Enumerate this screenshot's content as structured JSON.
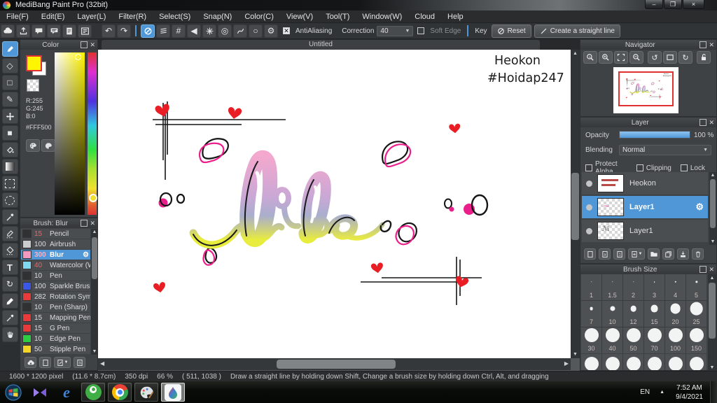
{
  "window": {
    "title": "MediBang Paint Pro (32bit)",
    "buttons": [
      "minimize",
      "restore",
      "close"
    ]
  },
  "menu": {
    "items": [
      "File(F)",
      "Edit(E)",
      "Layer(L)",
      "Filter(R)",
      "Select(S)",
      "Snap(N)",
      "Color(C)",
      "View(V)",
      "Tool(T)",
      "Window(W)",
      "Cloud",
      "Help"
    ]
  },
  "toolbar": {
    "icons": [
      "cloud",
      "export",
      "chat",
      "comment",
      "document",
      "panel-settings",
      "undo",
      "redo",
      "snap-off",
      "snap-parallel",
      "snap-grid",
      "snap-vanishing",
      "snap-radial",
      "snap-concentric",
      "snap-curve",
      "snap-ellipse",
      "snap-settings"
    ],
    "antialiasing_label": "AntiAliasing",
    "correction_label": "Correction",
    "correction_value": "40",
    "soft_edge_label": "Soft Edge",
    "key_label": "Key",
    "reset_label": "Reset",
    "straight_line_label": "Create a straight line"
  },
  "tools": {
    "items": [
      "brush",
      "eraser",
      "select-shape",
      "dot-pen",
      "move",
      "fill-shape",
      "bucket",
      "gradient",
      "select-rect",
      "lasso",
      "magic-wand",
      "select-pen",
      "select-eraser",
      "text",
      "operation",
      "pen",
      "eyedropper",
      "hand"
    ],
    "selected": "brush"
  },
  "color_panel": {
    "title": "Color",
    "r": "R:255",
    "g": "G:245",
    "b": "B:0",
    "hex": "#FFF500"
  },
  "brush_panel": {
    "title": "Brush: Blur",
    "footer_icons": [
      "cloud-upload",
      "add-brush",
      "edit-brush",
      "script-brush"
    ],
    "brushes": [
      {
        "size": "15",
        "name": "Pencil",
        "swatch": "#2f3133",
        "cls": "rednum"
      },
      {
        "size": "100",
        "name": "Airbrush",
        "swatch": "#c9cbcd"
      },
      {
        "size": "300",
        "name": "Blur",
        "swatch": "#f49ac1",
        "cls": "selected rednum"
      },
      {
        "size": "40",
        "name": "Watercolor (W",
        "swatch": "#7fd8ef",
        "cls": "rednum"
      },
      {
        "size": "10",
        "name": "Pen",
        "swatch": "#2f3133"
      },
      {
        "size": "100",
        "name": "Sparkle Brush",
        "swatch": "#3a57e8"
      },
      {
        "size": "282",
        "name": "Rotation Sym",
        "swatch": "#e83a3a"
      },
      {
        "size": "10",
        "name": "Pen (Sharp)",
        "swatch": "#2f3133"
      },
      {
        "size": "15",
        "name": "Mapping Pen",
        "swatch": "#e83a3a"
      },
      {
        "size": "15",
        "name": "G Pen",
        "swatch": "#e83a3a"
      },
      {
        "size": "10",
        "name": "Edge Pen",
        "swatch": "#2ecc40"
      },
      {
        "size": "50",
        "name": "Stipple Pen",
        "swatch": "#f5d523"
      }
    ]
  },
  "canvas": {
    "tab": "Untitled",
    "word": "like",
    "signature_line1": "Heokon",
    "signature_line2": "#Hoidap247"
  },
  "navigator": {
    "title": "Navigator",
    "icons": [
      "zoom-100",
      "zoom-in",
      "fit-screen",
      "zoom-out",
      "rotate-left",
      "reset-rotation",
      "rotate-right",
      "unlock"
    ]
  },
  "layer_panel": {
    "title": "Layer",
    "opacity_label": "Opacity",
    "opacity_value": "100 %",
    "blending_label": "Blending",
    "blending_value": "Normal",
    "checkboxes": [
      {
        "label": "Protect Alpha"
      },
      {
        "label": "Clipping"
      },
      {
        "label": "Lock"
      }
    ],
    "layers": [
      {
        "name": "Heokon",
        "cls": "t-heokon"
      },
      {
        "name": "Layer1",
        "cls": "selected t-squiggle"
      },
      {
        "name": "Layer1",
        "cls": "t-mark"
      }
    ],
    "footer_icons": [
      "new-layer",
      "new-8bit-layer",
      "new-1bit-layer",
      "add-layer-menu",
      "layer-folder",
      "duplicate-layer",
      "merge-layer",
      "delete-layer"
    ]
  },
  "brush_size_panel": {
    "title": "Brush Size",
    "sizes": [
      "1",
      "1.5",
      "2",
      "3",
      "4",
      "5",
      "7",
      "10",
      "12",
      "15",
      "20",
      "25",
      "30",
      "40",
      "50",
      "70",
      "100",
      "150"
    ]
  },
  "status": {
    "segments": [
      "1600 * 1200 pixel",
      "(11.6 * 8.7cm)",
      "350 dpi",
      "66 %",
      "( 511, 1038 )",
      "Draw a straight line by holding down Shift, Change a brush size by holding down Ctrl, Alt, and dragging"
    ]
  },
  "taskbar": {
    "icons": [
      "start",
      "kmplayer",
      "internet-explorer",
      "coccoc",
      "chrome",
      "paint-palette",
      "medibang-paint"
    ],
    "tray_lang": "EN",
    "time": "7:52 AM",
    "date": "9/4/2021"
  },
  "colors": {
    "accent": "#4f97d7",
    "fg-color": "#FFF500",
    "heart-red": "#e81e24",
    "magenta": "#ec1e8c",
    "ink": "#1a1a1a",
    "word-pink": "#f5a8cd",
    "word-mauve": "#c9a8d6",
    "word-gray": "#a9aecd",
    "word-yellow": "#e9ed3c"
  }
}
